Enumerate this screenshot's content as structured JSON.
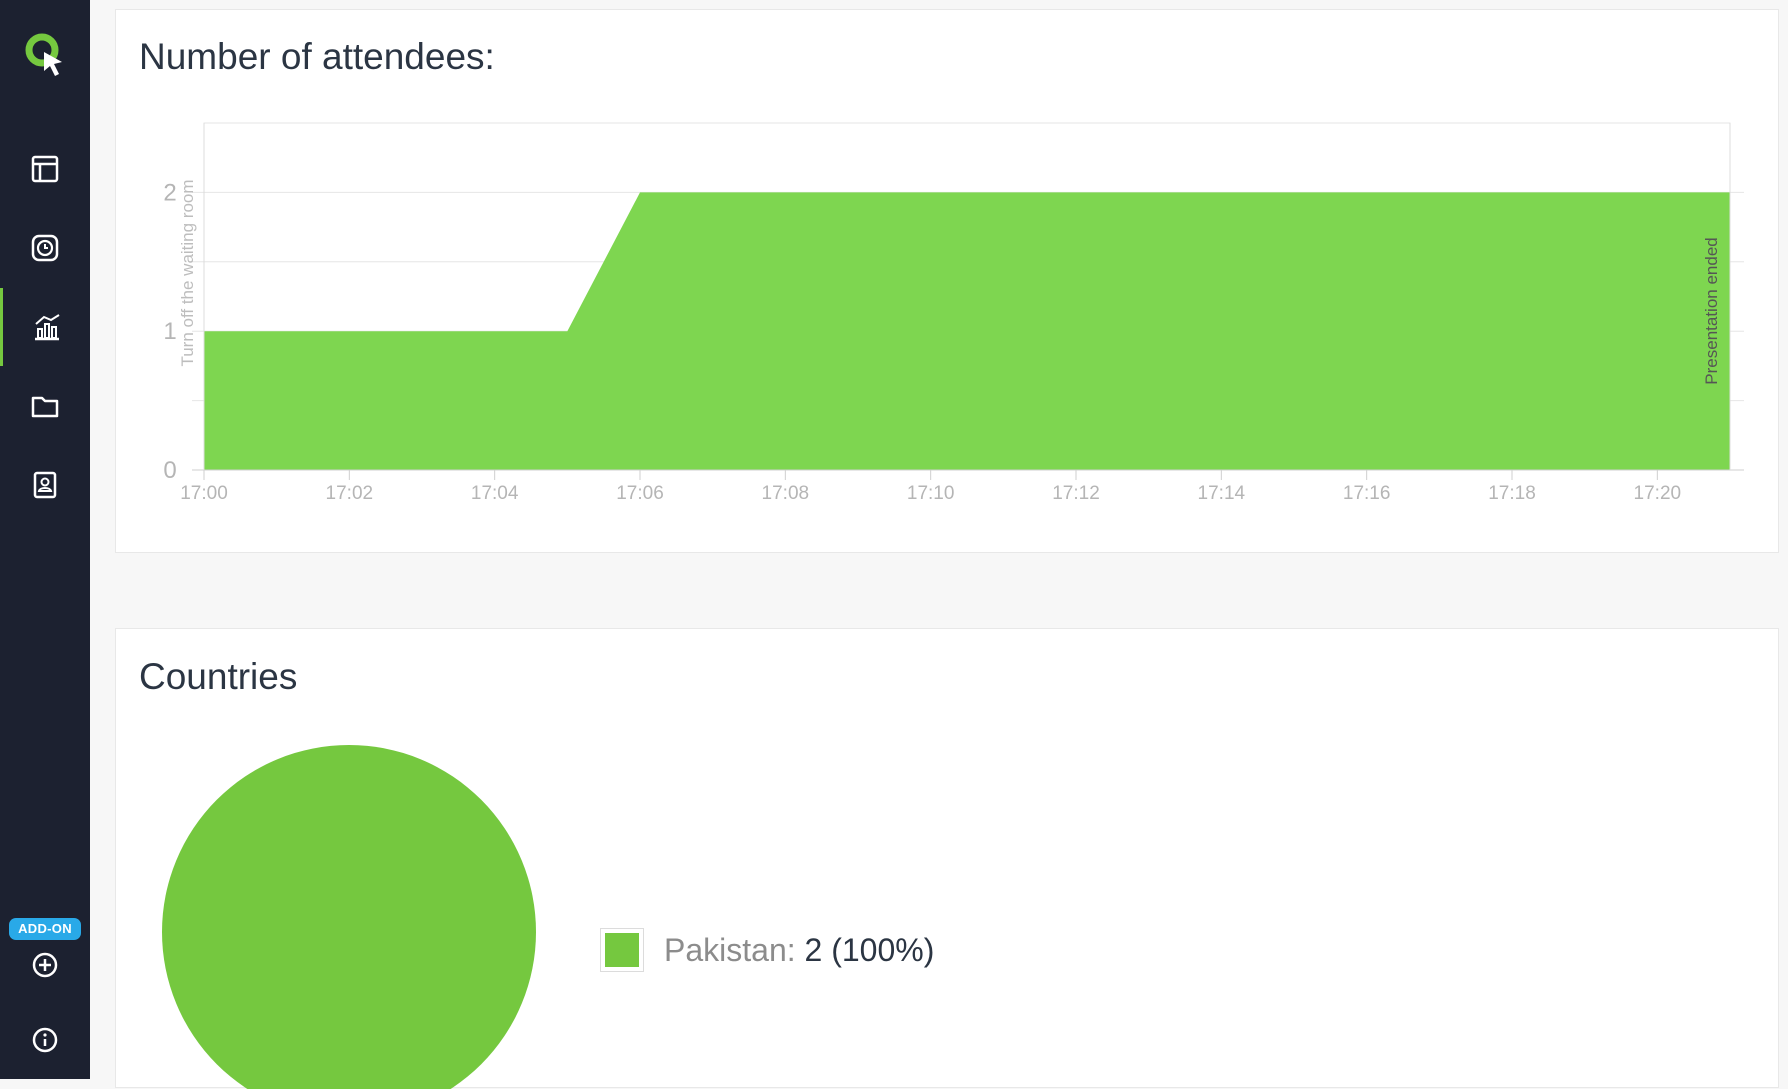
{
  "app": {
    "accent": "#75c83f",
    "sidebar_bg": "#1c2130",
    "badge_color": "#29a9e8"
  },
  "sidebar": {
    "logo_icon": "app-logo-icon",
    "items": [
      {
        "name": "sidebar-item-dashboard",
        "icon": "layout-icon",
        "active": false
      },
      {
        "name": "sidebar-item-schedule",
        "icon": "clock-icon",
        "active": false
      },
      {
        "name": "sidebar-item-statistics",
        "icon": "bar-chart-icon",
        "active": true
      },
      {
        "name": "sidebar-item-files",
        "icon": "folder-icon",
        "active": false
      },
      {
        "name": "sidebar-item-contacts",
        "icon": "contact-book-icon",
        "active": false
      }
    ],
    "addon_badge": "ADD-ON",
    "addon_icon": "plus-circle-icon",
    "info_icon": "info-icon"
  },
  "attendees": {
    "title": "Number of attendees:"
  },
  "countries": {
    "title": "Countries",
    "legend": [
      {
        "label": "Pakistan:",
        "value": "2 (100%)",
        "color": "#75c83f"
      }
    ]
  },
  "chart_data": [
    {
      "type": "area",
      "title": "Number of attendees:",
      "x_ticks": [
        "17:00",
        "17:02",
        "17:04",
        "17:06",
        "17:08",
        "17:10",
        "17:12",
        "17:14",
        "17:16",
        "17:18",
        "17:20"
      ],
      "x_range": [
        "17:00",
        "17:21"
      ],
      "y_ticks": [
        0,
        1,
        2
      ],
      "ylim": [
        0,
        2.5
      ],
      "grid": true,
      "series": [
        {
          "color": "#7ed650",
          "points": [
            {
              "x": "17:00",
              "y": 1
            },
            {
              "x": "17:05",
              "y": 1
            },
            {
              "x": "17:06",
              "y": 2
            },
            {
              "x": "17:21",
              "y": 2
            }
          ]
        }
      ],
      "annotations": [
        {
          "text": "Turn off the waiting room",
          "x": "17:00"
        },
        {
          "text": "Presentation ended",
          "x": "17:21"
        }
      ]
    },
    {
      "type": "pie",
      "title": "Countries",
      "slices": [
        {
          "label": "Pakistan",
          "value": 2,
          "percent": 100,
          "color": "#75c83f"
        }
      ]
    }
  ]
}
